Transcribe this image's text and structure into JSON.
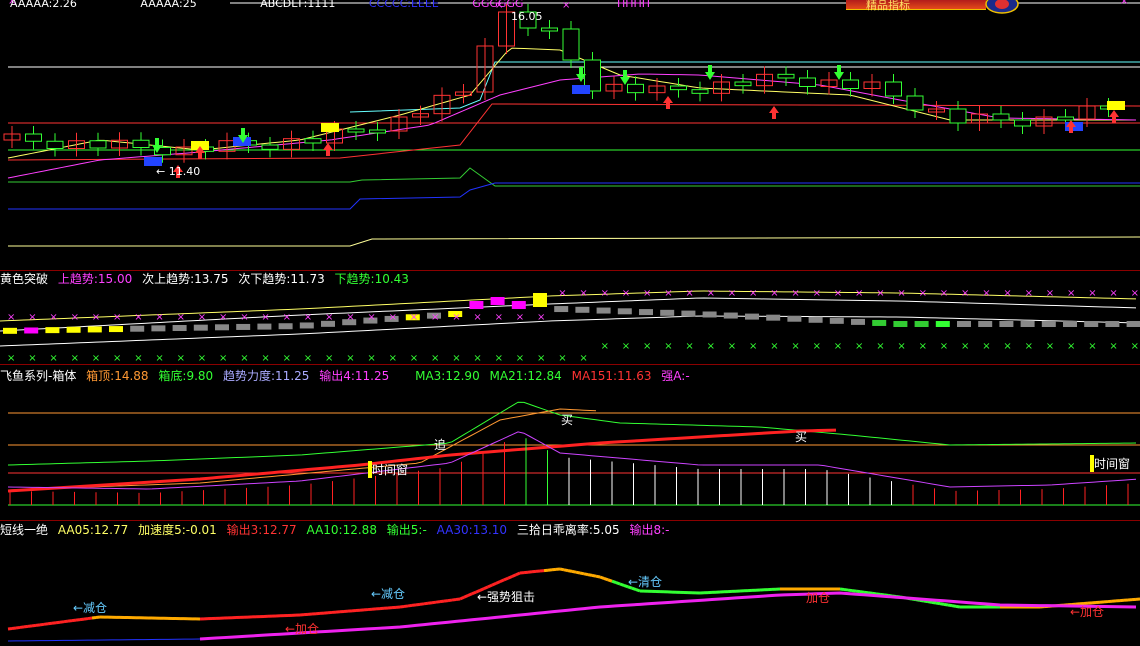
{
  "pane1": {
    "header_fragments": [
      "AAAAA:2.26",
      "AAAAA:25",
      "ABCDEF:1111",
      "CCCCC:EEEE",
      "GGGGGG",
      "HHHH"
    ],
    "peak_label": "16.05",
    "low_label": "← 11.40",
    "banner_text": "精品指标"
  },
  "pane2": {
    "title": "黄色突破",
    "items": [
      {
        "label": "上趋势:15.00",
        "color": "#ff40ff"
      },
      {
        "label": "次上趋势:13.75",
        "color": "#ffffff"
      },
      {
        "label": "次下趋势:11.73",
        "color": "#ffffff"
      },
      {
        "label": "下趋势:10.43",
        "color": "#33ff33"
      }
    ]
  },
  "pane3": {
    "title": "飞鱼系列-箱体",
    "items": [
      {
        "label": "箱顶:14.88",
        "color": "#ff9933"
      },
      {
        "label": "箱底:9.80",
        "color": "#33ff33"
      },
      {
        "label": "趋势力度:11.25",
        "color": "#aaaaff"
      },
      {
        "label": "输出4:11.25",
        "color": "#ff40ff"
      },
      {
        "label": "MA3:12.90",
        "color": "#33ff33"
      },
      {
        "label": "MA21:12.84",
        "color": "#33ff33"
      },
      {
        "label": "MA151:11.63",
        "color": "#ff3333"
      },
      {
        "label": "强A:-",
        "color": "#ff40ff"
      }
    ],
    "marks": {
      "chase": "追",
      "buy1": "买",
      "buy2": "买",
      "window1": "时间窗",
      "window2": "时间窗"
    }
  },
  "pane4": {
    "title": "短线一绝",
    "items": [
      {
        "label": "AA05:12.77",
        "color": "#ffff66"
      },
      {
        "label": "加速度5:-0.01",
        "color": "#ffff66"
      },
      {
        "label": "输出3:12.77",
        "color": "#ff3333"
      },
      {
        "label": "AA10:12.88",
        "color": "#33ff33"
      },
      {
        "label": "输出5:-",
        "color": "#33ff33"
      },
      {
        "label": "AA30:13.10",
        "color": "#3333ff"
      },
      {
        "label": "三拾日乖离率:5.05",
        "color": "#ffffff"
      },
      {
        "label": "输出8:-",
        "color": "#ff40ff"
      }
    ],
    "annotations": {
      "reduce1": "←减仓",
      "add1": "←加仓",
      "reduce2": "←减仓",
      "strong": "←强势狙击",
      "clear": "←清仓",
      "add2": "加仓",
      "add3": "←加仓"
    }
  },
  "colors": {
    "up": "#ff3333",
    "down": "#33ff33",
    "bg": "#000000",
    "divider": "#8b0000"
  }
}
